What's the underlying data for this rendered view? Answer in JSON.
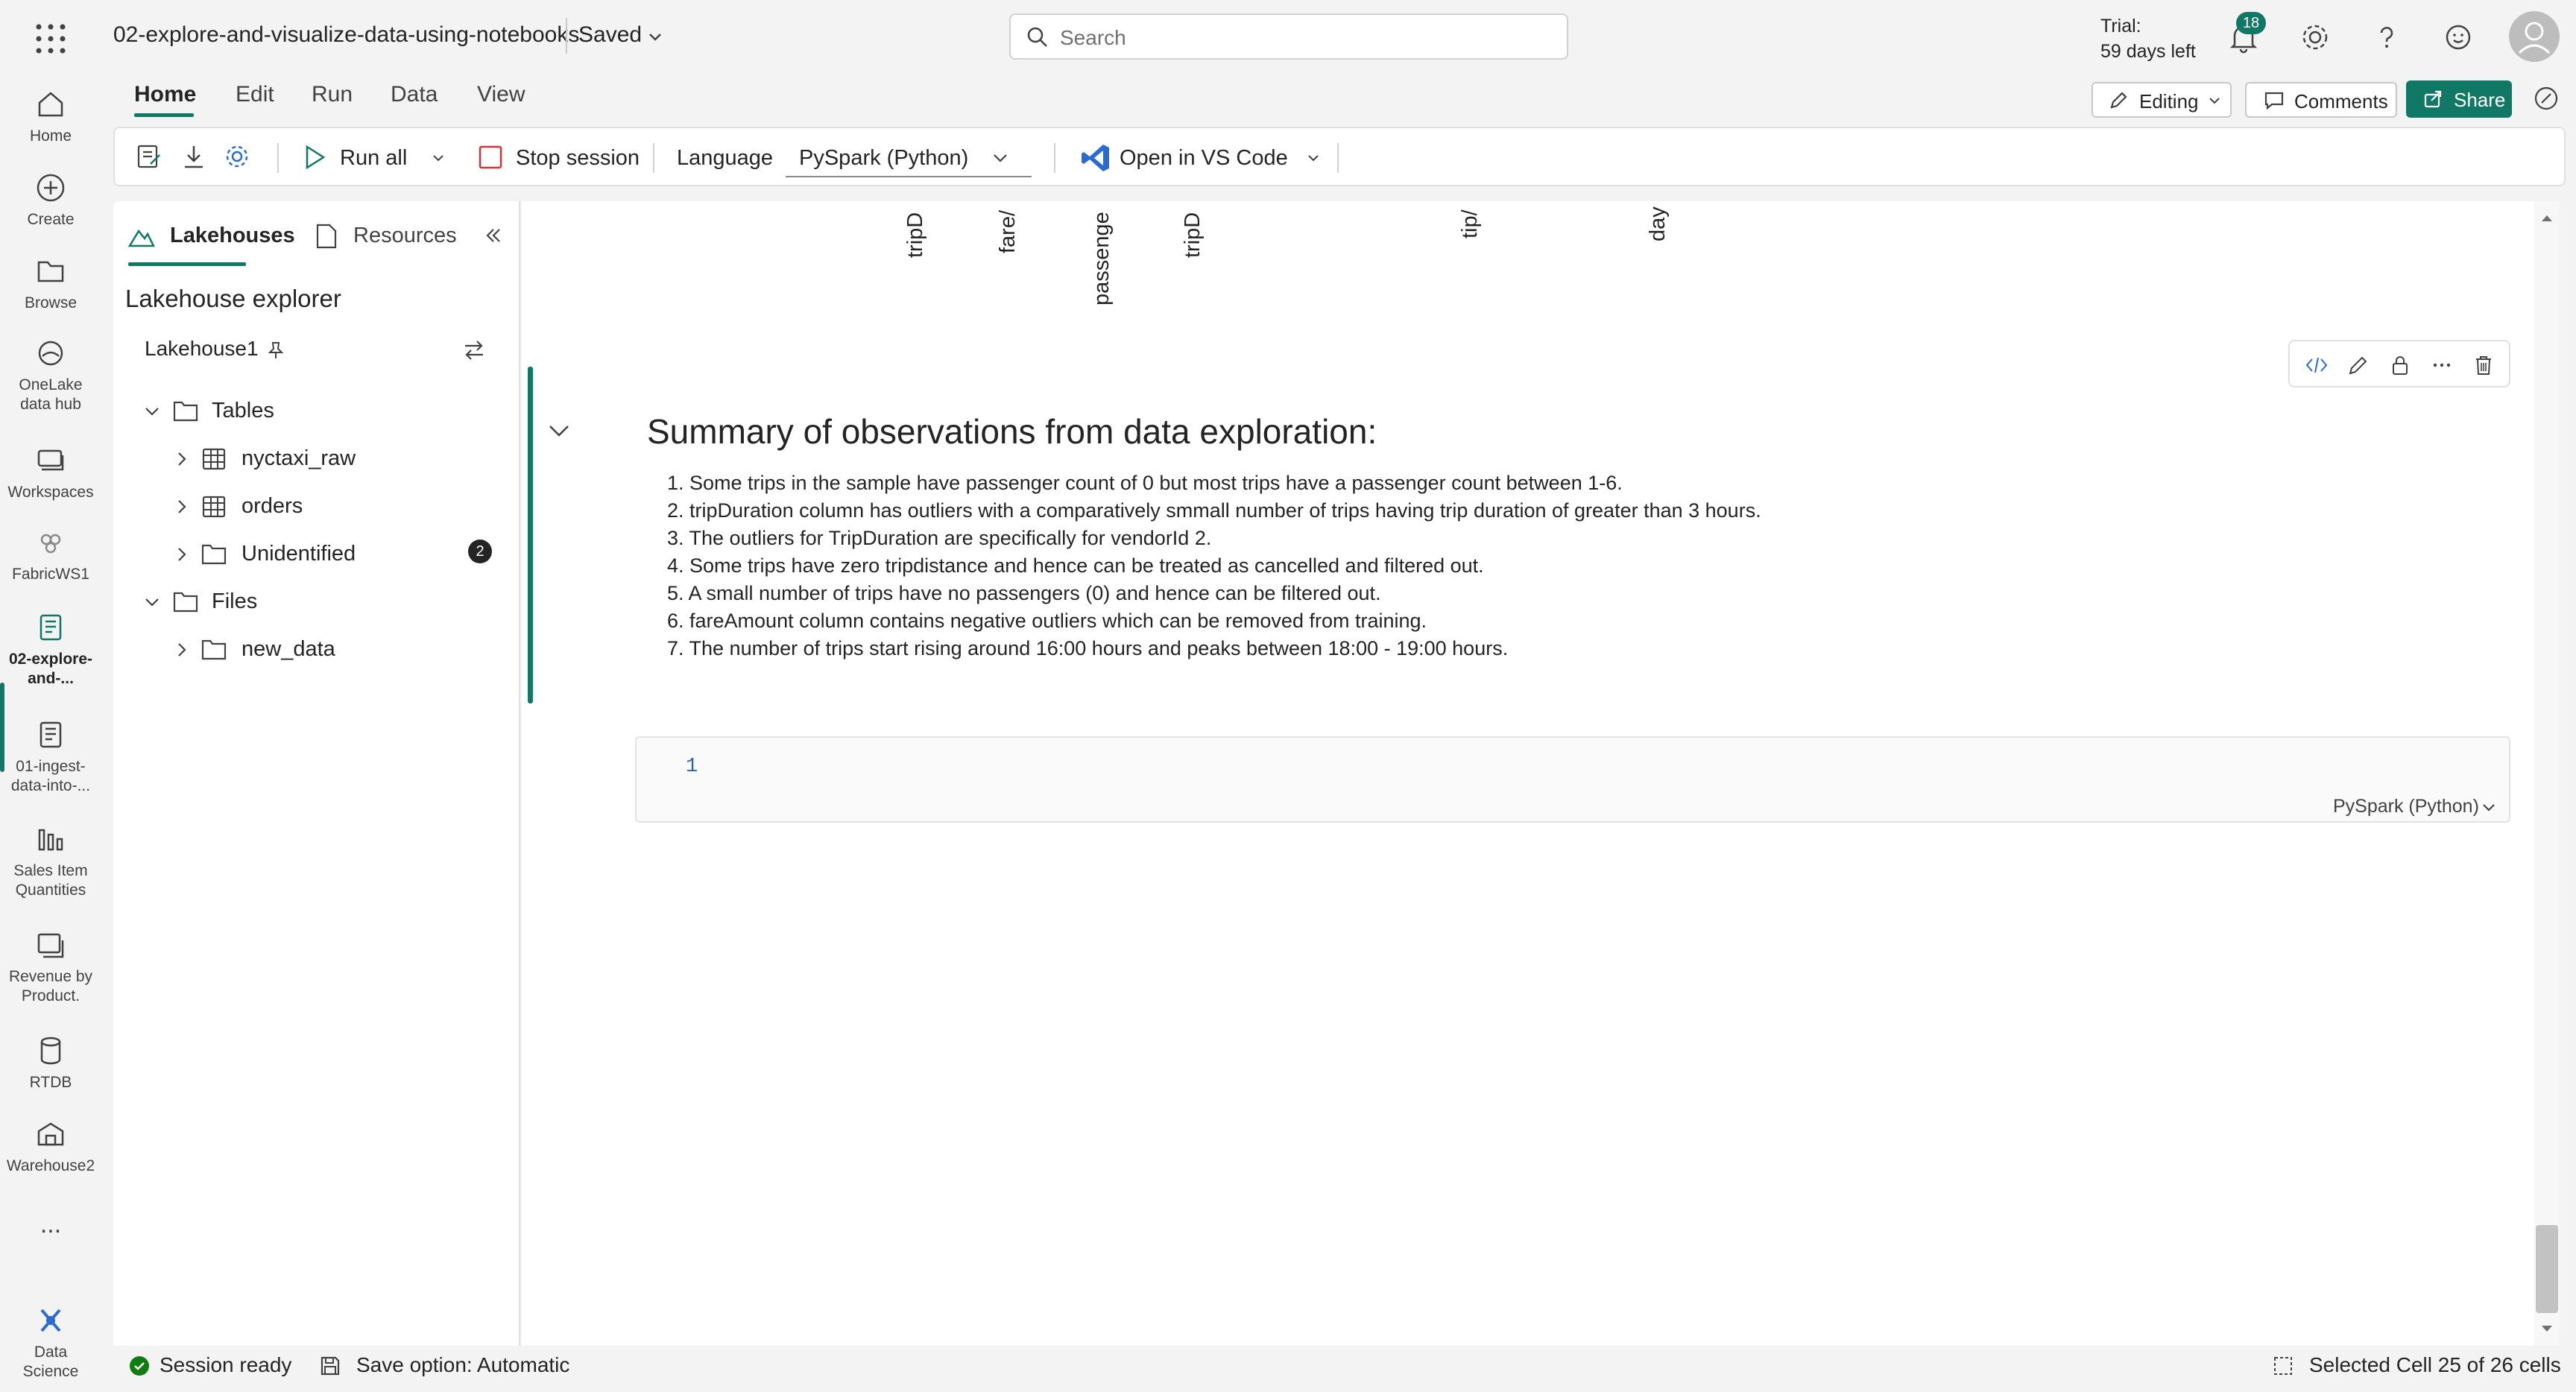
{
  "header": {
    "doc_title": "02-explore-and-visualize-data-using-notebooks",
    "saved_label": "Saved",
    "search_placeholder": "Search",
    "trial_line1": "Trial:",
    "trial_line2": "59 days left",
    "notification_count": "18"
  },
  "rail": {
    "items": [
      {
        "label": "Home",
        "icon": "home-icon"
      },
      {
        "label": "Create",
        "icon": "plus-circle-icon"
      },
      {
        "label": "Browse",
        "icon": "folder-icon"
      },
      {
        "label_lines": [
          "OneLake",
          "data hub"
        ],
        "icon": "onelake-icon"
      },
      {
        "label": "Workspaces",
        "icon": "workspaces-icon"
      },
      {
        "label": "FabricWS1",
        "icon": "fabric-ws-icon"
      },
      {
        "label_lines": [
          "02-explore-",
          "and-..."
        ],
        "icon": "notebook-icon"
      },
      {
        "label_lines": [
          "01-ingest-",
          "data-into-..."
        ],
        "icon": "notebook-icon"
      },
      {
        "label_lines": [
          "Sales Item",
          "Quantities"
        ],
        "icon": "bar-chart-icon"
      },
      {
        "label_lines": [
          "Revenue by",
          "Product."
        ],
        "icon": "report-icon"
      },
      {
        "label": "RTDB",
        "icon": "database-icon"
      },
      {
        "label": "Warehouse2",
        "icon": "warehouse-icon"
      }
    ],
    "more": "...",
    "bottom_lines": [
      "Data",
      "Science"
    ]
  },
  "ribbon": {
    "tabs": [
      "Home",
      "Edit",
      "Run",
      "Data",
      "View"
    ],
    "active_tab": "Home",
    "editing_label": "Editing",
    "comments_label": "Comments",
    "share_label": "Share"
  },
  "toolbar": {
    "run_all": "Run all",
    "stop_session": "Stop session",
    "language_label": "Language",
    "language_value": "PySpark (Python)",
    "vscode": "Open in VS Code"
  },
  "panel": {
    "tab_lakehouses": "Lakehouses",
    "tab_resources": "Resources",
    "title": "Lakehouse explorer",
    "lakehouse_name": "Lakehouse1",
    "tables_label": "Tables",
    "tables": [
      "nyctaxi_raw",
      "orders",
      "Unidentified"
    ],
    "unidentified_count": "2",
    "files_label": "Files",
    "files": [
      "new_data"
    ]
  },
  "notebook": {
    "rotated_labels": [
      "tripD",
      "fare/",
      "passenge",
      "tripD",
      "tip/",
      "day"
    ],
    "heading": "Summary of observations from data exploration:",
    "observations": [
      "1. Some trips in the sample have passenger count of 0 but most trips have a passenger count between 1-6.",
      "2. tripDuration column has outliers with a comparatively smmall number of trips having trip duration of greater than 3 hours.",
      "3. The outliers for TripDuration are specifically for vendorId 2.",
      "4. Some trips have zero tripdistance and hence can be treated as cancelled and filtered out.",
      "5. A small number of trips have no passengers (0) and hence can be filtered out.",
      "6. fareAmount column contains negative outliers which can be removed from training.",
      "7. The number of trips start rising around 16:00 hours and peaks between 18:00 - 19:00 hours."
    ],
    "code_line_number": "1",
    "code_language": "PySpark (Python)"
  },
  "status": {
    "session": "Session ready",
    "save_option": "Save option: Automatic",
    "selected": "Selected Cell 25 of 26 cells"
  },
  "colors": {
    "accent": "#117865"
  }
}
